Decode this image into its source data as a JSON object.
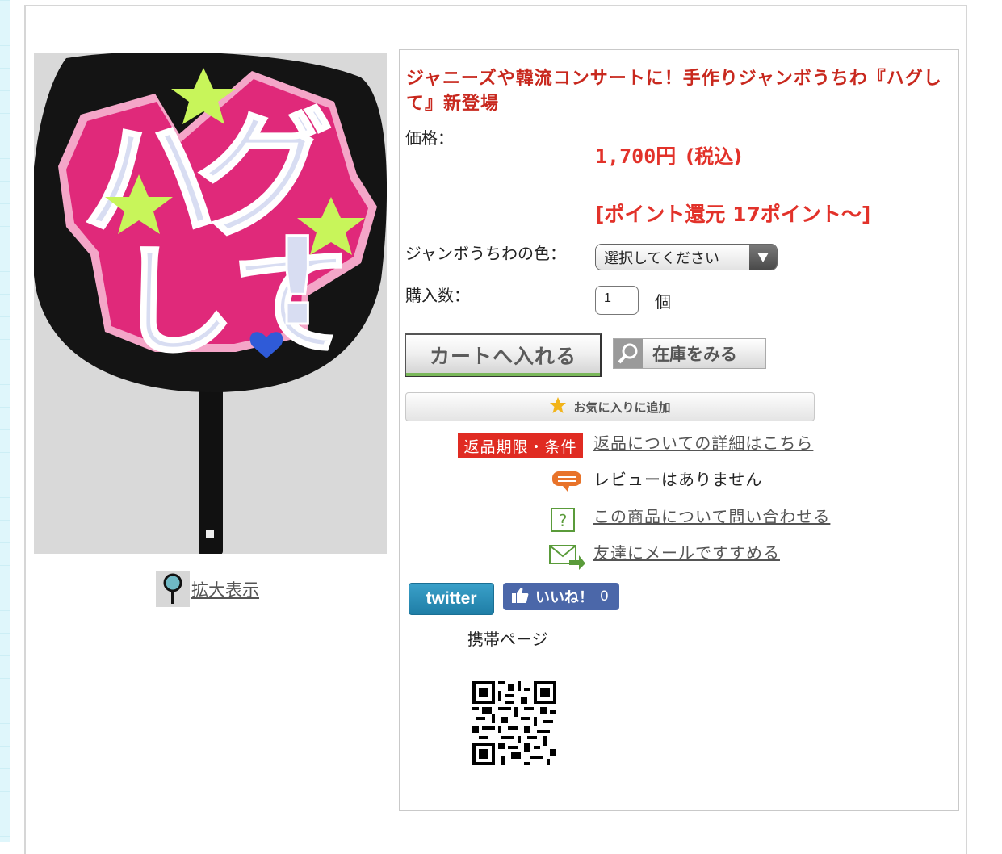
{
  "product": {
    "title": "ジャニーズや韓流コンサートに！手作りジャンボうちわ『ハグして』新登場",
    "image_alt_text": "ハグして！",
    "zoom_label": "拡大表示"
  },
  "price": {
    "label": "価格：",
    "amount": "1,700円",
    "tax_note": "(税込)",
    "points": "[ポイント還元 17ポイント～]"
  },
  "options": {
    "color_label": "ジャンボうちわの色：",
    "color_selected": "選択してください",
    "qty_label": "購入数：",
    "qty_value": "1",
    "qty_unit": "個"
  },
  "buttons": {
    "cart": "カートへ入れる",
    "stock": "在庫をみる",
    "favorite": "お気に入りに追加"
  },
  "links": {
    "return_badge": "返品期限・条件",
    "return_details": "返品についての詳細はこちら",
    "reviews": "レビューはありません",
    "inquiry": "この商品について問い合わせる",
    "recommend": "友達にメールですすめる"
  },
  "social": {
    "twitter": "twitter",
    "like_label": "いいね！",
    "like_count": "0"
  },
  "mobile": {
    "label": "携帯ページ"
  },
  "colors": {
    "title_red": "#c8281e",
    "price_red": "#e2322a",
    "uchiwa_pink": "#e0297a",
    "star_green": "#c8f55a"
  }
}
